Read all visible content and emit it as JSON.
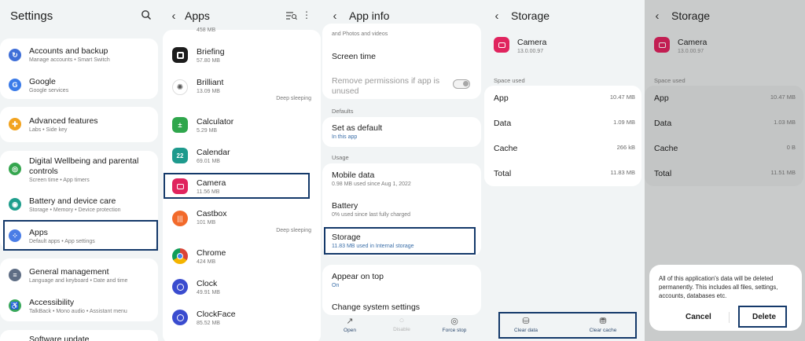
{
  "settings": {
    "title": "Settings",
    "search_icon": "search-icon",
    "items": [
      {
        "title": "Accounts and backup",
        "sub": "Manage accounts  •  Smart Switch",
        "icon_color": "#3f6fd8"
      },
      {
        "title": "Google",
        "sub": "Google services",
        "icon_color": "#3b7be8"
      },
      {
        "title": "Advanced features",
        "sub": "Labs  •  Side key",
        "icon_color": "#f2a31f"
      },
      {
        "title": "Digital Wellbeing and parental controls",
        "sub": "Screen time  •  App timers",
        "icon_color": "#35a64f"
      },
      {
        "title": "Battery and device care",
        "sub": "Storage  •  Memory  •  Device protection",
        "icon_color": "#1f9e8d"
      },
      {
        "title": "Apps",
        "sub": "Default apps  •  App settings",
        "icon_color": "#4a7de6"
      },
      {
        "title": "General management",
        "sub": "Language and keyboard  •  Date and time",
        "icon_color": "#5e6d84"
      },
      {
        "title": "Accessibility",
        "sub": "TalkBack  •  Mono audio  •  Assistant menu",
        "icon_color": "#3aa85c"
      },
      {
        "title": "Software update",
        "sub": "",
        "icon_color": "#6a6a8a"
      }
    ]
  },
  "apps": {
    "title": "Apps",
    "items": [
      {
        "name": "",
        "size": "458 MB",
        "note": ""
      },
      {
        "name": "Briefing",
        "size": "57.80 MB",
        "note": ""
      },
      {
        "name": "Brilliant",
        "size": "13.09 MB",
        "note": "Deep sleeping"
      },
      {
        "name": "Calculator",
        "size": "5.29 MB",
        "note": ""
      },
      {
        "name": "Calendar",
        "size": "69.01 MB",
        "note": ""
      },
      {
        "name": "Camera",
        "size": "11.56 MB",
        "note": ""
      },
      {
        "name": "Castbox",
        "size": "101 MB",
        "note": "Deep sleeping"
      },
      {
        "name": "Chrome",
        "size": "424 MB",
        "note": ""
      },
      {
        "name": "Clock",
        "size": "49.91 MB",
        "note": ""
      },
      {
        "name": "ClockFace",
        "size": "85.52 MB",
        "note": ""
      }
    ],
    "calendar_day": "22"
  },
  "app_info": {
    "title": "App info",
    "top_text": "and Photos and videos",
    "screen_time": "Screen time",
    "remove_permissions": "Remove permissions if app is unused",
    "defaults_header": "Defaults",
    "set_default": "Set as default",
    "set_default_sub": "In this app",
    "usage_header": "Usage",
    "mobile_data": "Mobile data",
    "mobile_data_sub": "0.98 MB used since Aug 1, 2022",
    "battery": "Battery",
    "battery_sub": "0% used since last fully charged",
    "storage": "Storage",
    "storage_sub": "11.83 MB used in Internal storage",
    "appear_on_top": "Appear on top",
    "appear_on_top_sub": "On",
    "change_settings": "Change system settings",
    "open": "Open",
    "disable": "Disable",
    "force_stop": "Force stop"
  },
  "storage": {
    "title": "Storage",
    "app_name": "Camera",
    "version": "13.0.00.97",
    "space_used": "Space used",
    "rows": [
      {
        "label": "App",
        "value": "10.47 MB"
      },
      {
        "label": "Data",
        "value": "1.09 MB"
      },
      {
        "label": "Cache",
        "value": "266 kB"
      },
      {
        "label": "Total",
        "value": "11.83 MB"
      }
    ],
    "clear_data": "Clear data",
    "clear_cache": "Clear cache"
  },
  "storage2": {
    "title": "Storage",
    "app_name": "Camera",
    "version": "13.0.00.97",
    "space_used": "Space used",
    "rows": [
      {
        "label": "App",
        "value": "10.47 MB"
      },
      {
        "label": "Data",
        "value": "1.03 MB"
      },
      {
        "label": "Cache",
        "value": "0 B"
      },
      {
        "label": "Total",
        "value": "11.51 MB"
      }
    ],
    "dialog_msg": "All of this application's data will be deleted permanently. This includes all files, settings, accounts, databases etc.",
    "cancel": "Cancel",
    "delete": "Delete"
  },
  "colors": {
    "highlight": "#14396a",
    "camera_icon": "#e0245e"
  }
}
